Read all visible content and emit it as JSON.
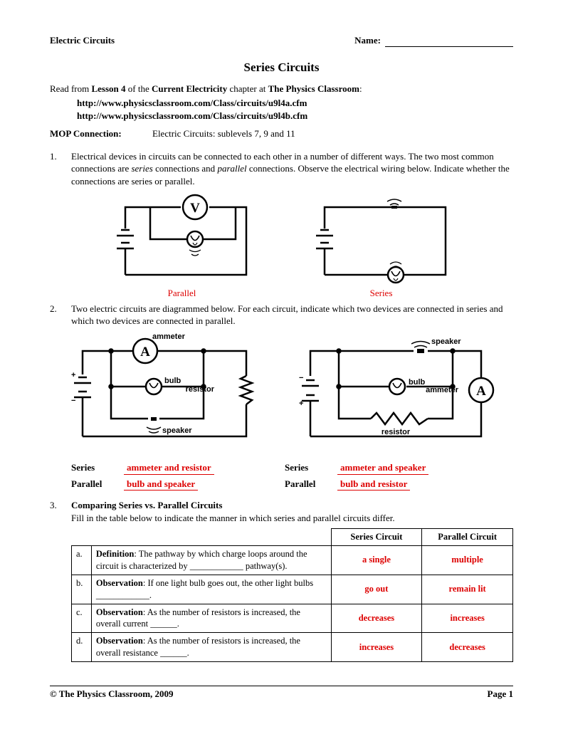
{
  "header": {
    "left": "Electric Circuits",
    "name_label": "Name:"
  },
  "title": "Series Circuits",
  "intro": {
    "prefix": "Read from ",
    "bold1": "Lesson 4",
    "mid1": " of the ",
    "bold2": "Current Electricity",
    "mid2": " chapter at ",
    "bold3": "The Physics Classroom",
    "suffix": ":"
  },
  "links": {
    "url1": "http://www.physicsclassroom.com/Class/circuits/u9l4a.cfm",
    "url2": "http://www.physicsclassroom.com/Class/circuits/u9l4b.cfm"
  },
  "mop": {
    "label": "MOP Connection:",
    "text": "Electric Circuits:  sublevels 7, 9 and 11"
  },
  "q1": {
    "num": "1.",
    "text_a": "Electrical devices in circuits can be connected to each other in a number of different ways.  The two most common connections are ",
    "italic1": "series",
    "text_b": " connections and ",
    "italic2": "parallel",
    "text_c": " connections.   Observe the electrical wiring below.  Indicate whether the connections are series or parallel.",
    "labels": {
      "left": "Parallel",
      "right": "Series"
    }
  },
  "q2": {
    "num": "2.",
    "text": "Two electric circuits are diagrammed below.  For each circuit, indicate which two devices are connected in series and which two devices are connected in parallel.",
    "svglabels": {
      "ammeter": "ammeter",
      "bulb": "bulb",
      "resistor": "resistor",
      "speaker": "speaker"
    },
    "answers": {
      "left_series_label": "Series",
      "left_series": "ammeter and resistor",
      "left_parallel_label": "Parallel",
      "left_parallel": "bulb and speaker",
      "right_series_label": "Series",
      "right_series": "ammeter and speaker",
      "right_parallel_label": "Parallel",
      "right_parallel": "bulb and resistor"
    }
  },
  "q3": {
    "num": "3.",
    "heading": "Comparing Series vs. Parallel Circuits",
    "subtext": "Fill in the table below to indicate the manner in which series and parallel circuits differ.",
    "th_series": "Series Circuit",
    "th_parallel": "Parallel Circuit",
    "rows": [
      {
        "letter": "a.",
        "bold": "Definition",
        "rest": ":  The pathway by which charge loops around the circuit is characterized by ____________ pathway(s).",
        "series": "a single",
        "parallel": "multiple"
      },
      {
        "letter": "b.",
        "bold": "Observation",
        "rest": ":  If one light bulb goes out, the other light bulbs ____________.",
        "series": "go out",
        "parallel": "remain lit"
      },
      {
        "letter": "c.",
        "bold": "Observation",
        "rest": ":  As the number of resistors is increased, the overall current ______.",
        "series": "decreases",
        "parallel": "increases"
      },
      {
        "letter": "d.",
        "bold": "Observation",
        "rest": ":  As the number of resistors is increased, the overall resistance ______.",
        "series": "increases",
        "parallel": "decreases"
      }
    ]
  },
  "footer": {
    "left": "©  The Physics Classroom, 2009",
    "right": "Page 1"
  }
}
